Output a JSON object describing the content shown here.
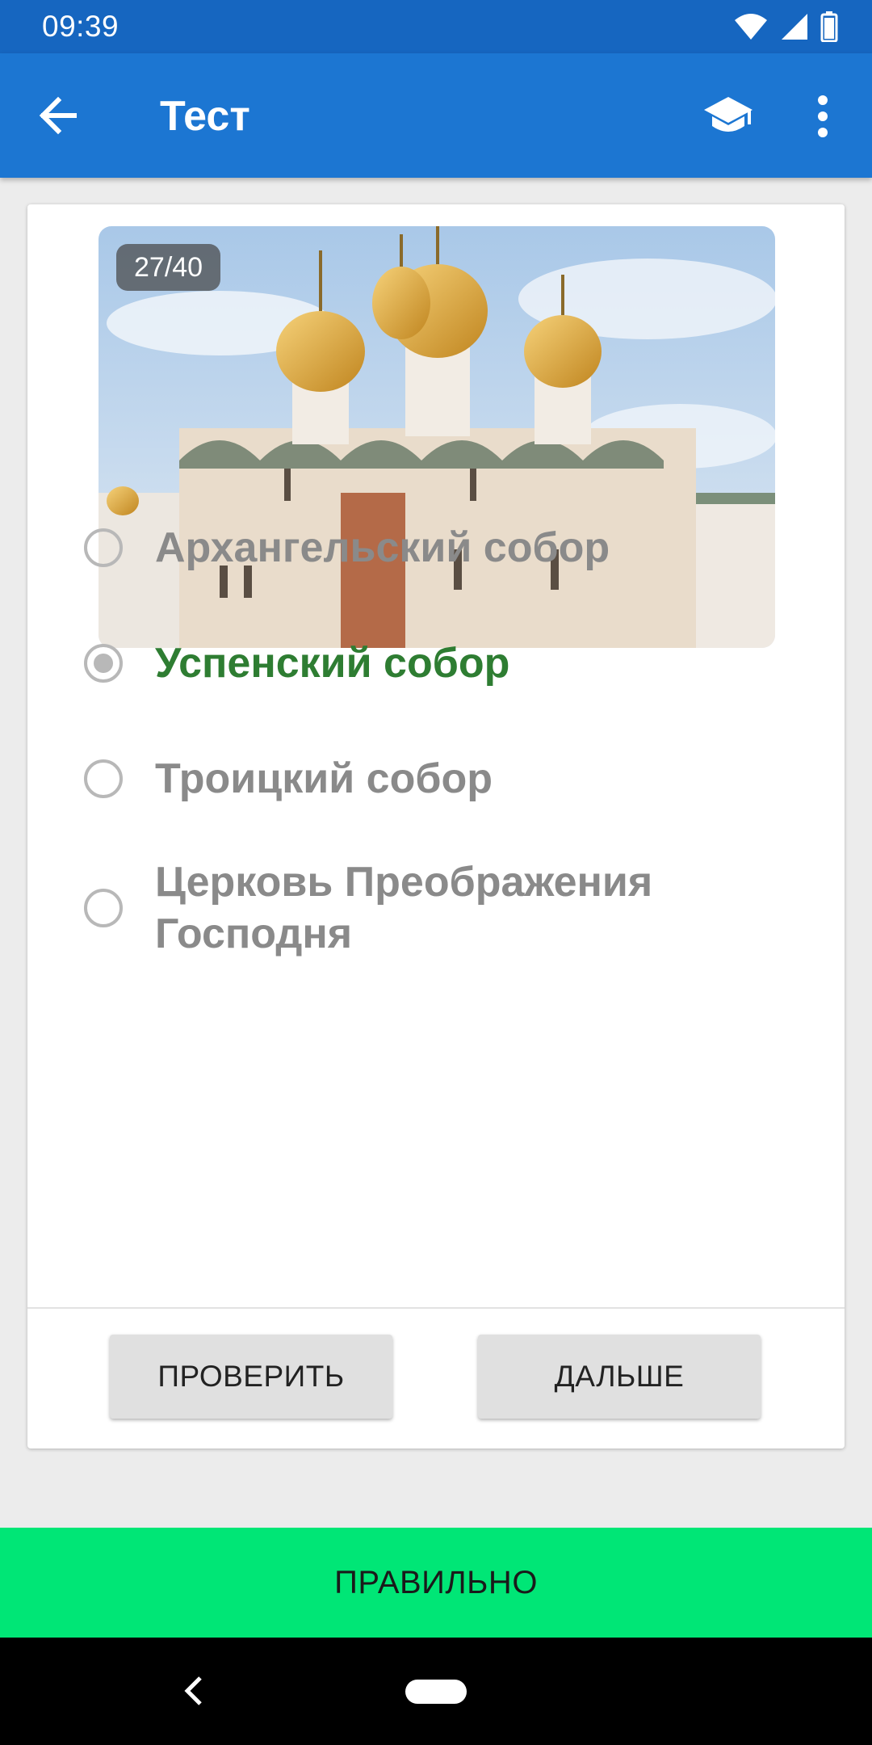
{
  "status_bar": {
    "time": "09:39",
    "icons": [
      "wifi-icon",
      "cell-signal-icon",
      "battery-icon"
    ]
  },
  "app_bar": {
    "title": "Тест",
    "back_icon": "arrow-back-icon",
    "learn_icon": "graduation-cap-icon",
    "menu_icon": "more-vert-icon",
    "color": "#1c76d2"
  },
  "question": {
    "counter": "27/40",
    "image_subject": "cathedral-photo"
  },
  "options": [
    {
      "label": "Архангельский собор",
      "selected": false,
      "correct": false
    },
    {
      "label": "Успенский собор",
      "selected": true,
      "correct": true
    },
    {
      "label": "Троицкий собор",
      "selected": false,
      "correct": false
    },
    {
      "label": "Церковь Преображения Господня",
      "selected": false,
      "correct": false
    }
  ],
  "buttons": {
    "check": "ПРОВЕРИТЬ",
    "next": "ДАЛЬШЕ"
  },
  "result": {
    "text": "ПРАВИЛЬНО",
    "color": "#00e676"
  },
  "colors": {
    "correct_text": "#2e7d32",
    "inactive_text": "#8a8a8a"
  }
}
